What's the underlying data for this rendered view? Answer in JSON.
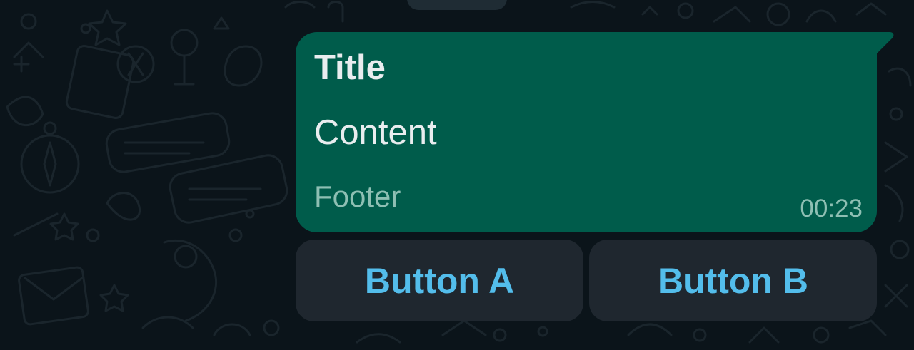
{
  "message": {
    "title": "Title",
    "content": "Content",
    "footer": "Footer",
    "time": "00:23"
  },
  "buttons": [
    {
      "label": "Button A"
    },
    {
      "label": "Button B"
    }
  ],
  "colors": {
    "background": "#0b141a",
    "bubble": "#005c4b",
    "button_bg": "#1f272f",
    "button_text": "#53bdeb",
    "footer_text": "#8ebfb3",
    "primary_text": "#e9edef"
  }
}
